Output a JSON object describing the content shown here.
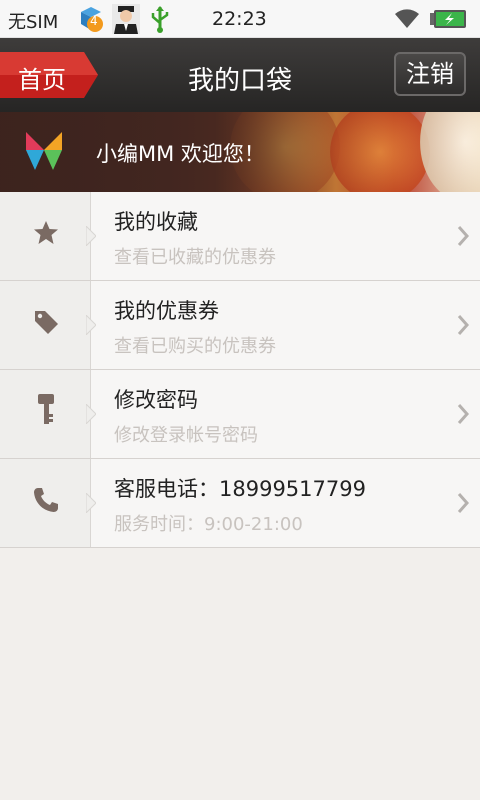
{
  "status_bar": {
    "carrier": "无SIM",
    "notification_badge": "4",
    "time": "22:23"
  },
  "header": {
    "home_label": "首页",
    "title": "我的口袋",
    "logout_label": "注销"
  },
  "banner": {
    "welcome": "小编MM  欢迎您！"
  },
  "menu": [
    {
      "icon": "star-icon",
      "title": "我的收藏",
      "subtitle": "查看已收藏的优惠券"
    },
    {
      "icon": "tag-icon",
      "title": "我的优惠券",
      "subtitle": "查看已购买的优惠券"
    },
    {
      "icon": "key-icon",
      "title": "修改密码",
      "subtitle": "修改登录帐号密码"
    },
    {
      "icon": "phone-icon",
      "title": "客服电话：18999517799",
      "subtitle": "服务时间：9:00-21:00"
    }
  ],
  "colors": {
    "header_bg": "#2e2d2c",
    "home_red": "#c4201d",
    "icon_brown": "#7a6a63",
    "subtitle_gray": "#c8c3bf"
  }
}
